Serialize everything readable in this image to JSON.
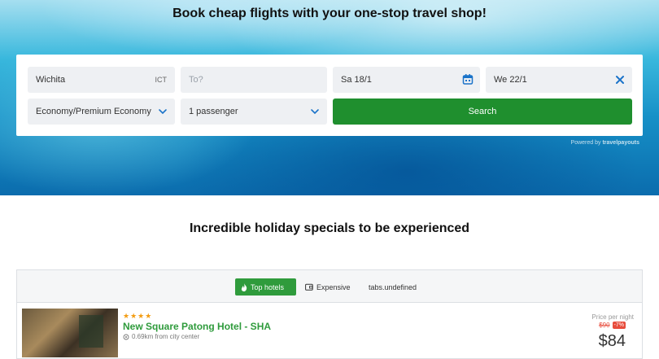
{
  "hero": {
    "title": "Book cheap flights with your one-stop travel shop!"
  },
  "search": {
    "from_value": "Wichita",
    "from_code": "ICT",
    "to_placeholder": "To?",
    "depart_date": "Sa 18/1",
    "return_date": "We 22/1",
    "class_value": "Economy/Premium Economy",
    "passengers_value": "1 passenger",
    "search_label": "Search",
    "powered_prefix": "Powered by",
    "powered_brand": "travelpayouts"
  },
  "specials": {
    "title": "Incredible holiday specials to be experienced"
  },
  "hotels": {
    "tabs": [
      {
        "label": "Top hotels",
        "icon": "flame-icon",
        "active": true
      },
      {
        "label": "Expensive",
        "icon": "wallet-icon",
        "active": false
      },
      {
        "label": "tabs.undefined",
        "icon": "",
        "active": false
      }
    ],
    "items": [
      {
        "stars": "★★★★",
        "name": "New Square Patong Hotel - SHA",
        "distance": "0.69km from city center",
        "price_label": "Price per night",
        "old_price": "$90",
        "discount": "-7%",
        "price": "$84"
      }
    ]
  },
  "colors": {
    "accent_green": "#1f8f2e",
    "hotel_name_green": "#2f9b3c",
    "discount_red": "#e74c3c",
    "calendar_blue": "#1a73c9"
  }
}
